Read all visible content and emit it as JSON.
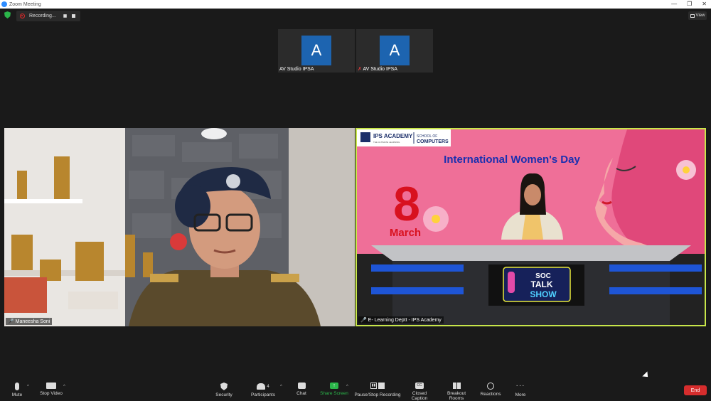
{
  "window": {
    "title": "Zoom Meeting"
  },
  "recording": {
    "label": "Recording..."
  },
  "view": {
    "label": "View"
  },
  "thumbnails": [
    {
      "initial": "A",
      "name": "AV Studio IPSA",
      "muted": false
    },
    {
      "initial": "A",
      "name": "AV Studio IPSA",
      "muted": true
    }
  ],
  "videos": {
    "left": {
      "name": "Maneesha Soni"
    },
    "right": {
      "name": "E- Learning Deptt - IPS Academy",
      "logo": {
        "brand": "IPS ACADEMY",
        "tagline": "THE ULTIMATE LEARNING",
        "dept_line1": "SCHOOL OF",
        "dept_line2": "COMPUTERS"
      },
      "headline": "International Women's Day",
      "date_number": "8",
      "date_month": "March",
      "show_line1": "SOC",
      "show_line2": "TALK",
      "show_line3": "SHOW"
    }
  },
  "toolbar": {
    "mute": "Mute",
    "stop_video": "Stop Video",
    "security": "Security",
    "participants": "Participants",
    "participants_count": "4",
    "chat": "Chat",
    "share_screen": "Share Screen",
    "pause_stop_recording": "Pause/Stop Recording",
    "closed_caption": "Closed Caption",
    "breakout_rooms": "Breakout Rooms",
    "reactions": "Reactions",
    "more": "More",
    "end": "End"
  },
  "colors": {
    "accent_green": "#2bb54a",
    "end_red": "#d62d2d",
    "avatar_blue": "#1d64b0",
    "active_border": "#c8e64a"
  }
}
